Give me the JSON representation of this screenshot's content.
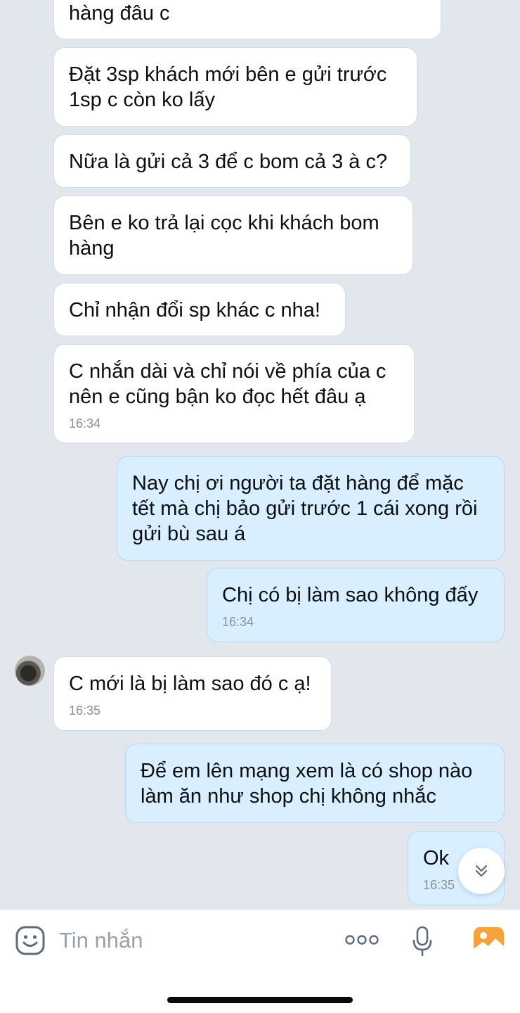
{
  "messages": [
    {
      "text": "hàng đâu c",
      "time": ""
    },
    {
      "text": "Đặt 3sp khách mới bên e gửi trước\n1sp c còn ko lấy",
      "time": ""
    },
    {
      "text": "Nữa là gửi cả 3 để c bom cả 3 à c?",
      "time": ""
    },
    {
      "text": "Bên e ko trả lại cọc khi khách bom\nhàng",
      "time": ""
    },
    {
      "text": "Chỉ nhận đổi sp khác c nha!",
      "time": ""
    },
    {
      "text": "C nhắn dài và chỉ nói về phía của c\nnên e cũng bận ko đọc hết đâu ạ",
      "time": "16:34"
    },
    {
      "text": "Nay chị ơi người ta đặt hàng để mặc\ntết mà chị bảo gửi trước 1 cái xong rồi\ngửi bù sau á",
      "time": ""
    },
    {
      "text": "Chị có bị làm sao không đấy",
      "time": "16:34"
    },
    {
      "text": "C mới là bị làm sao đó c ạ!",
      "time": "16:35"
    },
    {
      "text": "Để em lên mạng xem là có shop nào\nlàm ăn như shop chị không nhắc",
      "time": ""
    },
    {
      "text": "Ok",
      "time": "16:35"
    }
  ],
  "senders": [
    "other",
    "other",
    "other",
    "other",
    "other",
    "other",
    "me",
    "me",
    "other",
    "me",
    "me"
  ],
  "input": {
    "placeholder": "Tin nhắn"
  },
  "icons": {
    "emoji": "smiley-sticker-icon",
    "more": "more-options-icon",
    "mic": "microphone-icon",
    "image": "photo-gallery-icon",
    "scroll": "double-chevron-down-icon"
  },
  "colors": {
    "background": "#e2e7ed",
    "incoming_bubble": "#ffffff",
    "outgoing_bubble": "#d9efff",
    "image_icon": "#f7a23a"
  }
}
